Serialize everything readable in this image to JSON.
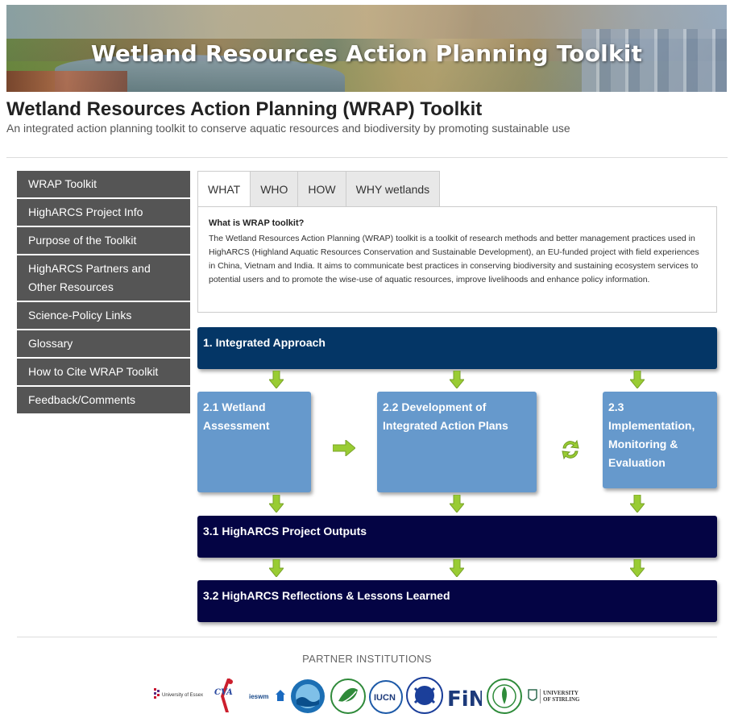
{
  "banner": {
    "title": "Wetland Resources Action Planning Toolkit"
  },
  "header": {
    "title": "Wetland Resources Action Planning (WRAP) Toolkit",
    "subtitle": "An integrated action planning toolkit to conserve aquatic resources and biodiversity by promoting sustainable use"
  },
  "sidebar": {
    "items": [
      {
        "label": "WRAP Toolkit"
      },
      {
        "label": "HighARCS Project Info"
      },
      {
        "label": "Purpose of the Toolkit"
      },
      {
        "label": "HighARCS Partners and Other Resources"
      },
      {
        "label": "Science-Policy Links"
      },
      {
        "label": "Glossary"
      },
      {
        "label": "How to Cite WRAP Toolkit"
      },
      {
        "label": "Feedback/Comments"
      }
    ]
  },
  "tabs": {
    "items": [
      {
        "label": "WHAT",
        "active": true
      },
      {
        "label": "WHO",
        "active": false
      },
      {
        "label": "HOW",
        "active": false
      },
      {
        "label": "WHY wetlands",
        "active": false
      }
    ],
    "panel": {
      "heading": "What is WRAP toolkit?",
      "text": "The Wetland Resources Action Planning (WRAP) toolkit is a toolkit of research methods and better management practices used in HighARCS (Highland Aquatic Resources Conservation and Sustainable Development), an EU-funded project with field experiences in China, Vietnam and India. It aims to communicate best practices in conserving biodiversity and sustaining ecosystem services to potential users and to promote the wise-use of aquatic resources, improve livelihoods and enhance policy information."
    }
  },
  "flow": {
    "integrated": "1. Integrated Approach",
    "assessment": "2.1 Wetland Assessment",
    "development": "2.2 Development of Integrated Action Plans",
    "implementation": "2.3 Implementation, Monitoring & Evaluation",
    "outputs": "3.1 HighARCS Project Outputs",
    "reflections": "3.2 HighARCS Reflections & Lessons Learned"
  },
  "partners": {
    "title": "PARTNER INSTITUTIONS",
    "logos": [
      "University of Essex",
      "CVA",
      "ieswm",
      "IUCN",
      "FiN",
      "UNIVERSITY OF STIRLING"
    ]
  },
  "colors": {
    "sidebar": "#555555",
    "flow_dark": "#043666",
    "flow_mid": "#6699cc",
    "flow_navy": "#040444",
    "arrow_green": "#99cc33"
  }
}
